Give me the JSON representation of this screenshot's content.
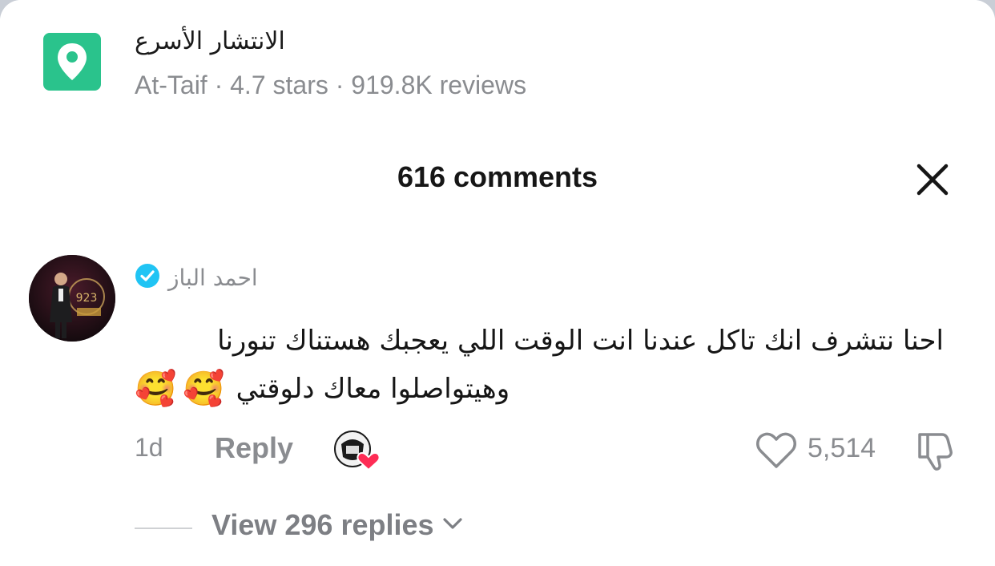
{
  "place": {
    "title": "الانتشار الأسرع",
    "meta": "At-Taif · 4.7 stars · 919.8K reviews",
    "icon": "location-pin-icon",
    "icon_color": "#2ac38c"
  },
  "comments_header": {
    "title": "616 comments",
    "close_icon": "close-icon"
  },
  "comment": {
    "username": "احمد الباز",
    "verified_icon": "verified-badge-icon",
    "verified_color": "#20c4f4",
    "text_line1": "احنا نتشرف انك تاكل عندنا انت الوقت اللي يعجبك هستناك تنورنا",
    "text_line2": "وهيتواصلوا معاك دلوقتي",
    "emojis": [
      "🥰",
      "🥰"
    ],
    "time": "1d",
    "reply_label": "Reply",
    "likes": "5,514",
    "view_replies_label": "View 296 replies",
    "like_color": "#fe2c55"
  }
}
